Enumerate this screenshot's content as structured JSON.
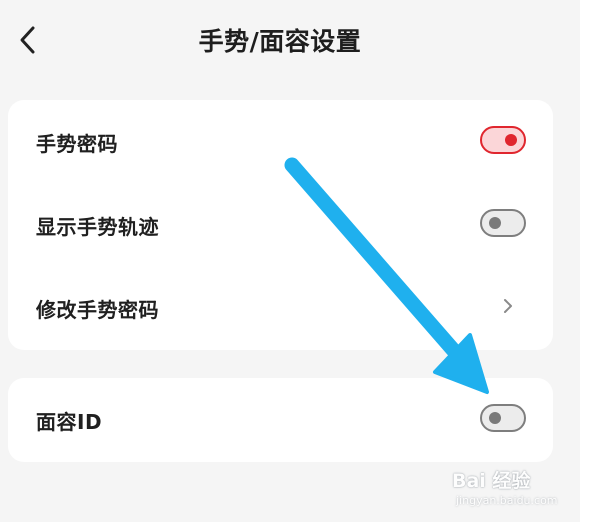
{
  "header": {
    "title": "手势/面容设置",
    "back_icon": "chevron-left-icon"
  },
  "gesture_card": {
    "rows": [
      {
        "label": "手势密码",
        "control": "toggle",
        "on": true
      },
      {
        "label": "显示手势轨迹",
        "control": "toggle",
        "on": false
      },
      {
        "label": "修改手势密码",
        "control": "chevron",
        "icon": "chevron-right-icon"
      }
    ]
  },
  "face_card": {
    "rows": [
      {
        "label": "面容ID",
        "control": "toggle",
        "on": false
      }
    ]
  },
  "annotation": {
    "icon": "arrow-annotation-icon",
    "color": "#1fb0ee"
  },
  "watermark": {
    "main": "Bai 经验",
    "sub": "jingyan.baidu.com"
  },
  "colors": {
    "background": "#f5f5f5",
    "card": "#ffffff",
    "toggle_on": "#e0262e",
    "toggle_off": "#7a7a7a"
  }
}
